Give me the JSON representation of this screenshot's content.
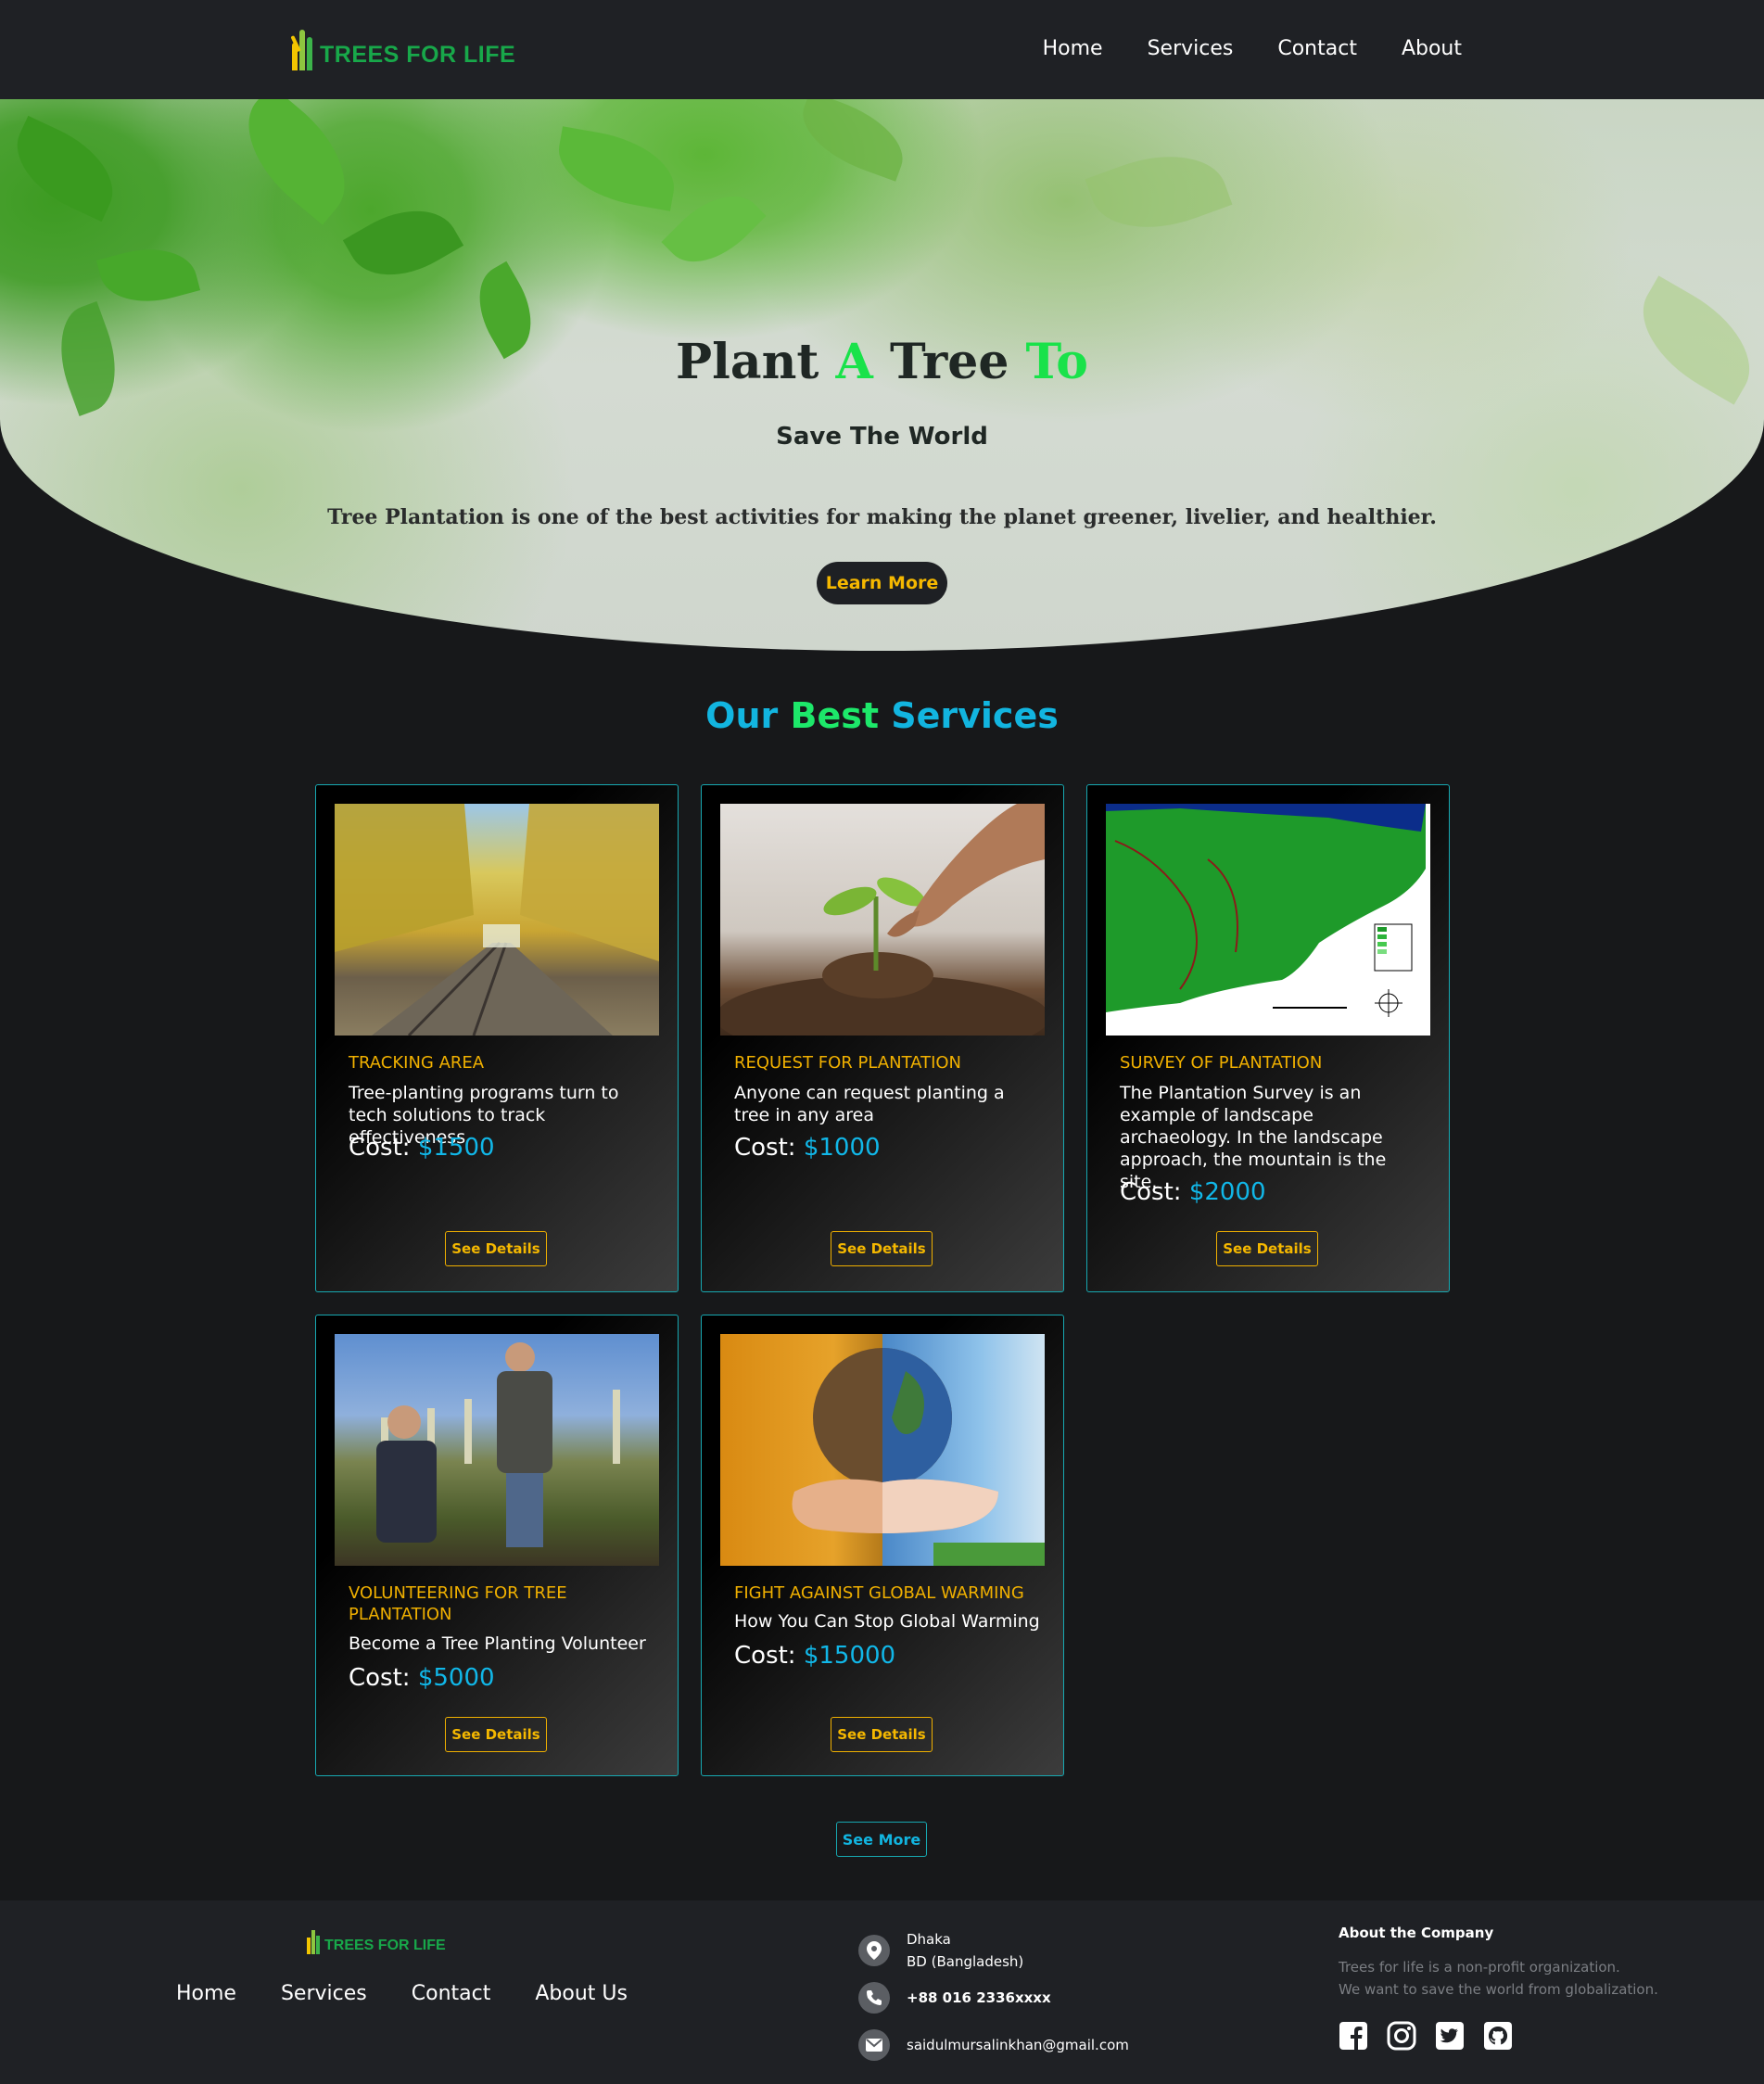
{
  "nav": {
    "logo_text": "TREES FOR LIFE",
    "links": [
      "Home",
      "Services",
      "Contact",
      "About"
    ]
  },
  "hero": {
    "title_part1": "Plant ",
    "title_part2": "A",
    "title_part3": " Tree ",
    "title_part4": "To",
    "subtitle": "Save The World",
    "description": "Tree Plantation is one of the best activities for making the planet greener, livelier, and healthier.",
    "cta_label": "Learn More"
  },
  "services": {
    "title_part1": "Our ",
    "title_part2": "Best",
    "title_part3": " Services",
    "cost_label": "Cost: ",
    "details_label": "See Details",
    "see_more_label": "See More",
    "cards": [
      {
        "title": "TRACKING AREA",
        "description": "Tree-planting programs turn to tech solutions to track effectiveness",
        "cost": "$1500",
        "image": "autumn-railway-image"
      },
      {
        "title": "REQUEST FOR PLANTATION",
        "description": "Anyone can request planting a tree in any area",
        "cost": "$1000",
        "image": "seedling-hand-image"
      },
      {
        "title": "SURVEY OF PLANTATION",
        "description": "The Plantation Survey is an example of landscape archaeology. In the landscape approach, the mountain is the site.",
        "cost": "$2000",
        "image": "survey-map-image"
      },
      {
        "title": "VOLUNTEERING FOR TREE PLANTATION",
        "description": "Become a Tree Planting Volunteer",
        "cost": "$5000",
        "image": "volunteers-image"
      },
      {
        "title": "FIGHT AGAINST GLOBAL WARMING",
        "description": "How You Can Stop Global Warming",
        "cost": "$15000",
        "image": "earth-in-hands-image"
      }
    ]
  },
  "footer": {
    "logo_text": "TREES FOR LIFE",
    "links": [
      "Home",
      "Services",
      "Contact",
      "About Us"
    ],
    "address_line1": "Dhaka",
    "address_line2": "BD (Bangladesh)",
    "phone": "+88 016 2336xxxx",
    "email": "saidulmursalinkhan@gmail.com",
    "about_title": "About the Company",
    "about_line1": "Trees for life is a non-profit organization.",
    "about_line2": "We want to save the world from globalization.",
    "socials": [
      "facebook-icon",
      "instagram-icon",
      "twitter-icon",
      "github-icon"
    ]
  },
  "colors": {
    "accent_green": "#19e24a",
    "accent_cyan": "#12b5e0",
    "accent_gold": "#f5b800",
    "nav_bg": "#1f2125",
    "page_bg": "#17181a"
  }
}
